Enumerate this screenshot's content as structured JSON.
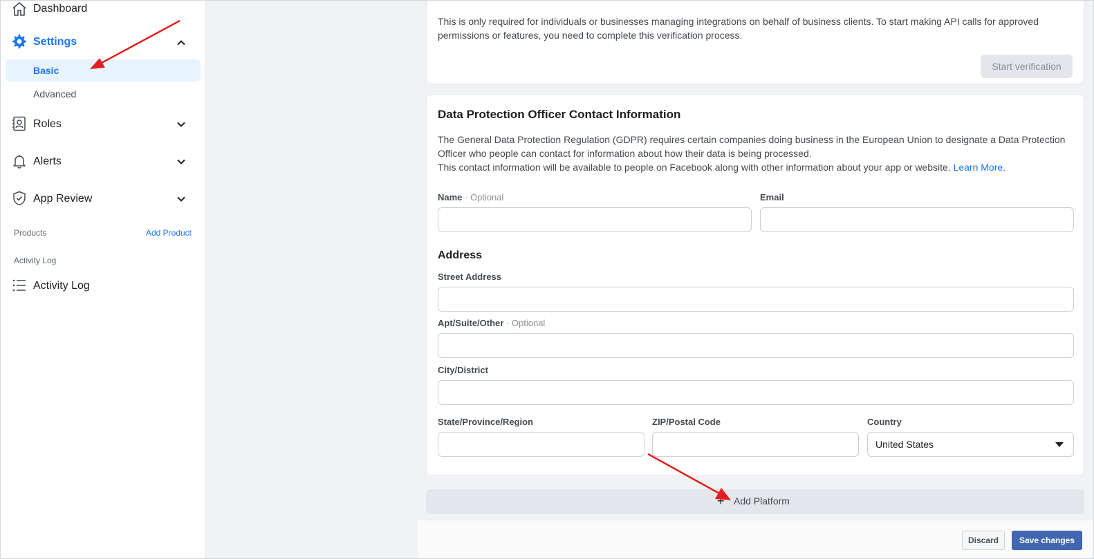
{
  "sidebar": {
    "dashboard_label": "Dashboard",
    "settings_label": "Settings",
    "settings_sub": [
      "Basic",
      "Advanced"
    ],
    "roles_label": "Roles",
    "alerts_label": "Alerts",
    "app_review_label": "App Review",
    "products_label": "Products",
    "add_product_label": "Add Product",
    "activity_log_section": "Activity Log",
    "activity_log_label": "Activity Log"
  },
  "verification": {
    "text": "This is only required for individuals or businesses managing integrations on behalf of business clients. To start making API calls for approved permissions or features, you need to complete this verification process.",
    "button_label": "Start verification"
  },
  "dpo": {
    "title": "Data Protection Officer Contact Information",
    "text1": "The General Data Protection Regulation (GDPR) requires certain companies doing business in the European Union to designate a Data Protection Officer who people can contact for information about how their data is being processed.",
    "text2": "This contact information will be available to people on Facebook along with other information about your app or website.",
    "learn_more": "Learn More.",
    "name_label": "Name",
    "optional_suffix": " · Optional",
    "email_label": "Email",
    "address_heading": "Address",
    "street_label": "Street Address",
    "apt_label": "Apt/Suite/Other",
    "city_label": "City/District",
    "state_label": "State/Province/Region",
    "zip_label": "ZIP/Postal Code",
    "country_label": "Country",
    "country_value": "United States"
  },
  "add_platform_label": "Add Platform",
  "footer": {
    "discard_label": "Discard",
    "save_label": "Save changes"
  },
  "colors": {
    "accent": "#1877f2",
    "save_button": "#4267b2",
    "annotation_arrow": "#e02020"
  }
}
